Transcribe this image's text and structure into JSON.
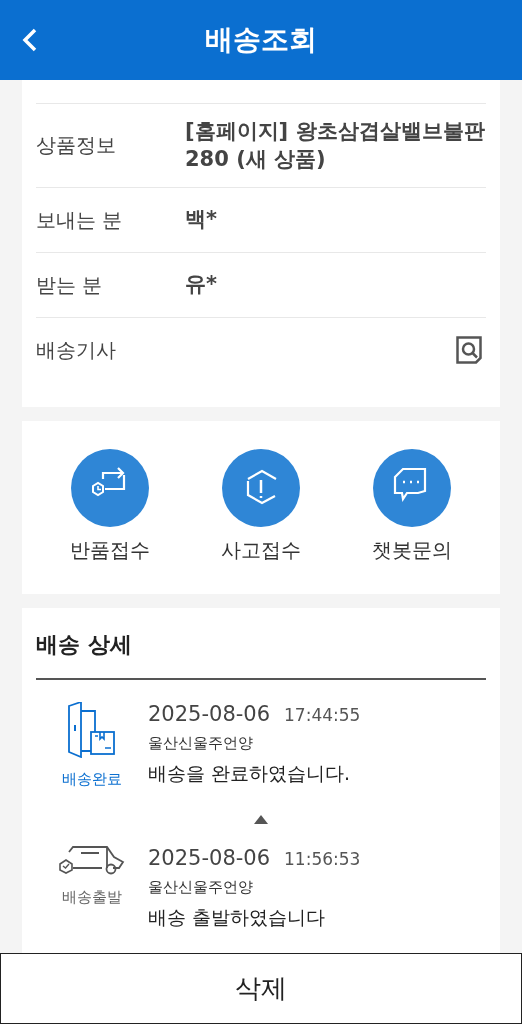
{
  "header": {
    "title": "배송조회"
  },
  "info_rows": [
    {
      "kind": "text",
      "label": "상품정보",
      "value": "[홈페이지] 왕초삼겹살밸브불판280 (새 상품)"
    },
    {
      "kind": "text",
      "label": "보내는 분",
      "value": "백*"
    },
    {
      "kind": "text",
      "label": "받는 분",
      "value": "유*"
    },
    {
      "kind": "action",
      "label": "배송기사"
    }
  ],
  "actions": [
    {
      "kind": "return",
      "label": "반품접수"
    },
    {
      "kind": "accident",
      "label": "사고접수"
    },
    {
      "kind": "chat",
      "label": "챗봇문의"
    }
  ],
  "detail": {
    "title": "배송 상세",
    "events": [
      {
        "kind": "delivered",
        "status": "배송완료",
        "date": "2025-08-06",
        "time": "17:44:55",
        "location": "울산신울주언양",
        "message": "배송을 완료하였습니다."
      },
      {
        "kind": "departed",
        "status": "배송출발",
        "date": "2025-08-06",
        "time": "11:56:53",
        "location": "울산신울주언양",
        "message": "배송 출발하였습니다"
      }
    ]
  },
  "delete_button": "삭제"
}
